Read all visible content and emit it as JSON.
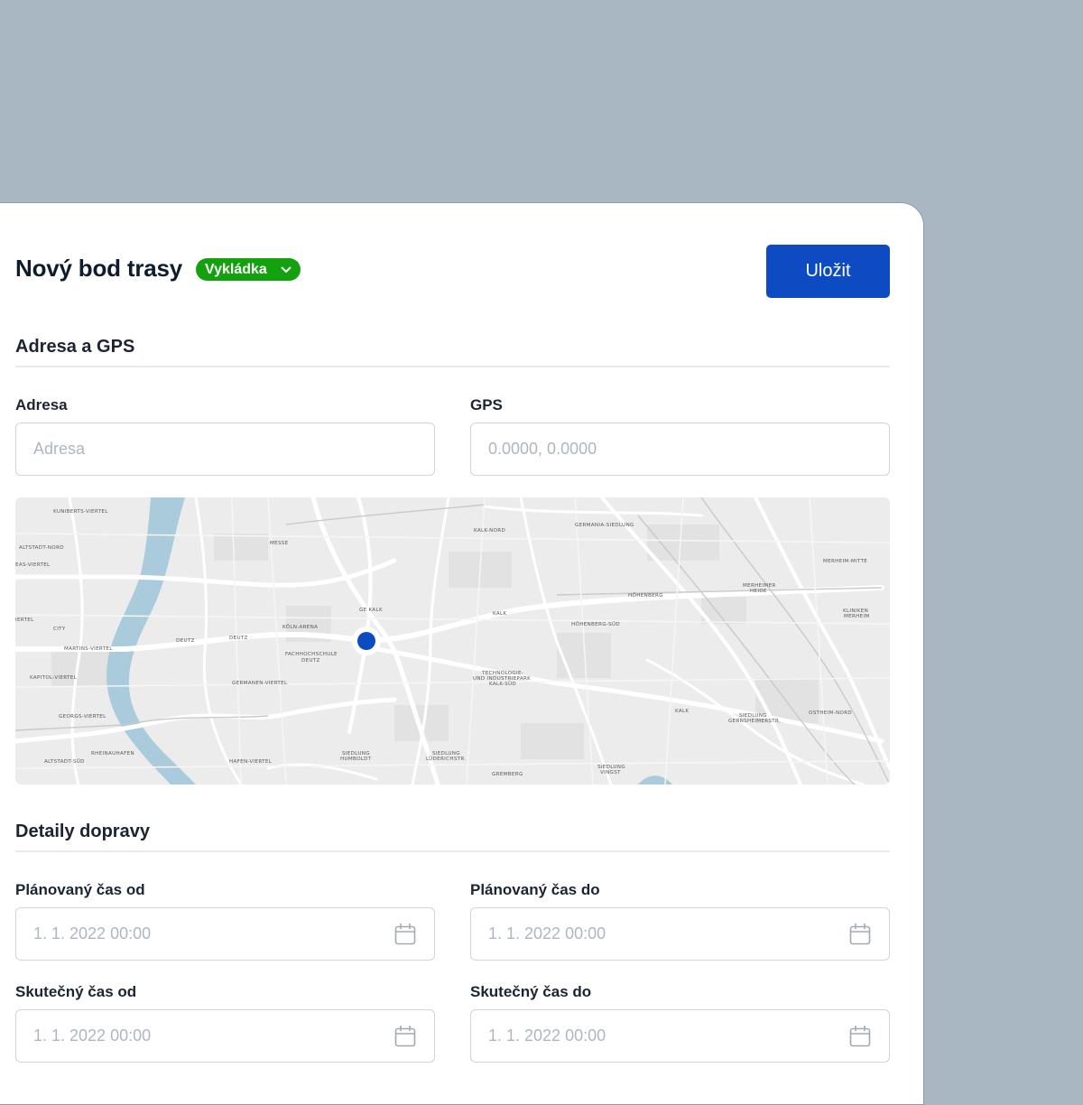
{
  "header": {
    "title": "Nový bod trasy",
    "type_badge": "Vykládka",
    "save_label": "Uložit"
  },
  "address_section": {
    "title": "Adresa a GPS",
    "address_label": "Adresa",
    "address_placeholder": "Adresa",
    "address_value": "",
    "gps_label": "GPS",
    "gps_placeholder": "0.0000, 0.0000",
    "gps_value": ""
  },
  "map": {
    "water_color": "#aacbdb",
    "marker_color": "#0c4bc2",
    "labels": [
      "KUNIBERTS-VIERTEL",
      "ALTSTADT-NORD",
      "EAS-VIERTEL",
      "IERTEL",
      "CITY",
      "MARTINS-VIERTEL",
      "KAPITOL-VIERTEL",
      "GEORGS-VIERTEL",
      "ALTSTADT-SÜD",
      "RHEINAUHAFEN",
      "MESSE",
      "DEUTZ",
      "DEUTZ",
      "KÖLN-ARENA",
      "FACHHOCHSCHULE",
      "DEUTZ",
      "GERMANEN-VIERTEL",
      "HAFEN-VIERTEL",
      "GE KALK",
      "KALK-NORD",
      "KALK",
      "TECHNOLOGIE-",
      "UND INDUSTRIEPARK",
      "KALK-SÜD",
      "SIEDLUNG",
      "HUMBOLDT",
      "SIEDLUNG",
      "LÜDERICHSTR.",
      "GREMBERG",
      "GERMANIA-SIEDLUNG",
      "HÖHENBERG",
      "HÖHENBERG-SÜD",
      "MERHEIMER",
      "HEIDE",
      "MERHEIM-MITTE",
      "KLINIKEN",
      "MERHEIM",
      "KALK",
      "SIEDLUNG",
      "GERNSHEIMERSTR.",
      "OSTHEIM-NORD",
      "SIEDLUNG",
      "VINGST"
    ]
  },
  "transport_section": {
    "title": "Detaily dopravy",
    "planned_from_label": "Plánovaný čas od",
    "planned_from_placeholder": "1. 1. 2022 00:00",
    "planned_to_label": "Plánovaný čas do",
    "planned_to_placeholder": "1. 1. 2022 00:00",
    "actual_from_label": "Skutečný čas od",
    "actual_from_placeholder": "1. 1. 2022 00:00",
    "actual_to_label": "Skutečný čas do",
    "actual_to_placeholder": "1. 1. 2022 00:00"
  },
  "icons": {
    "badge_chevron": "chevron-down-icon",
    "date_picker": "calendar-icon",
    "map_marker": "location-marker-icon"
  },
  "colors": {
    "background": "#a8b7c2",
    "primary": "#0c4bc2",
    "badge_green": "#13a10e",
    "text": "#1a2433",
    "placeholder": "#aeb6bf"
  }
}
